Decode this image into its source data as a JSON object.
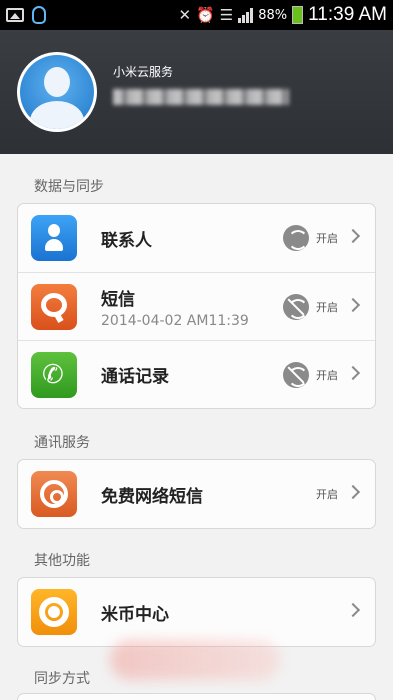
{
  "status_bar": {
    "battery": "88%",
    "time": "11:39 AM",
    "icons": [
      "picture-icon",
      "qq-icon",
      "mute-icon",
      "alarm-icon",
      "wifi-icon",
      "signal-icon",
      "battery-icon"
    ]
  },
  "header": {
    "service_name": "小米云服务"
  },
  "sections": {
    "data_sync": "数据与同步",
    "comm_service": "通讯服务",
    "other": "其他功能",
    "sync_mode": "同步方式"
  },
  "items": {
    "contacts": {
      "title": "联系人",
      "status": "开启",
      "icon": "contacts-icon"
    },
    "sms": {
      "title": "短信",
      "subtitle": "2014-04-02 AM11:39",
      "status": "开启",
      "icon": "sms-icon"
    },
    "call_log": {
      "title": "通话记录",
      "status": "开启",
      "icon": "phone-icon"
    },
    "net_sms": {
      "title": "免费网络短信",
      "status": "开启",
      "icon": "net-sms-icon"
    },
    "mi_coin": {
      "title": "米币中心",
      "icon": "mi-coin-icon"
    }
  },
  "colors": {
    "header_bg": "#2d3035",
    "contacts": "#1a73d1",
    "sms": "#d9511b",
    "call_log": "#2f9a1f",
    "mi_coin": "#f08f0a"
  }
}
